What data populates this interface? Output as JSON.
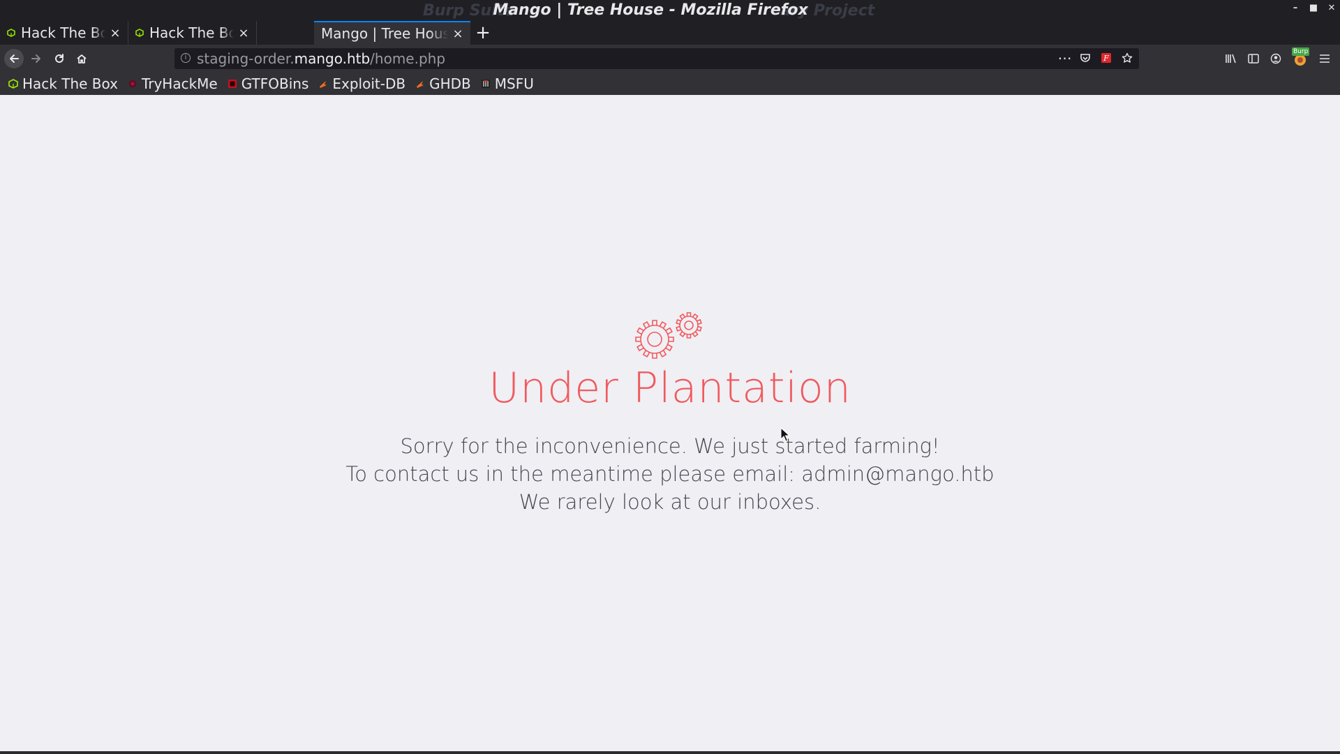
{
  "window": {
    "title": "Mango | Tree House - Mozilla Firefox",
    "ghost_left": "Burp Suite",
    "ghost_right": "ary Project"
  },
  "tabs": [
    {
      "label": "Hack The Box :: Mango",
      "active": false
    },
    {
      "label": "Hack The Box :: Mango",
      "active": false
    },
    {
      "label": "Mango | Tree House",
      "active": true
    }
  ],
  "urlbar": {
    "prefix": "staging-order.",
    "host": "mango.htb",
    "path": "/home.php"
  },
  "toolbar": {
    "burp_badge": "Burp"
  },
  "bookmarks": [
    {
      "label": "Hack The Box",
      "icon": "htb-cube-icon",
      "color": "#9fef00"
    },
    {
      "label": "TryHackMe",
      "icon": "tryhackme-icon",
      "color": "#a3123b"
    },
    {
      "label": "GTFOBins",
      "icon": "gtfobins-icon",
      "color": "#c0121f"
    },
    {
      "label": "Exploit-DB",
      "icon": "exploitdb-icon",
      "color": "#f26b21"
    },
    {
      "label": "GHDB",
      "icon": "ghdb-icon",
      "color": "#f26b21"
    },
    {
      "label": "MSFU",
      "icon": "msfu-icon",
      "color": "#c9c9c9"
    }
  ],
  "page": {
    "headline": "Under Plantation",
    "line1": "Sorry for the inconvenience. We just started farming!",
    "line2": "To contact us in the meantime please email: admin@mango.htb",
    "line3": "We rarely look at our inboxes.",
    "accent_color": "#f05a5e",
    "text_color": "#44474d",
    "background": "#f0eff4"
  }
}
